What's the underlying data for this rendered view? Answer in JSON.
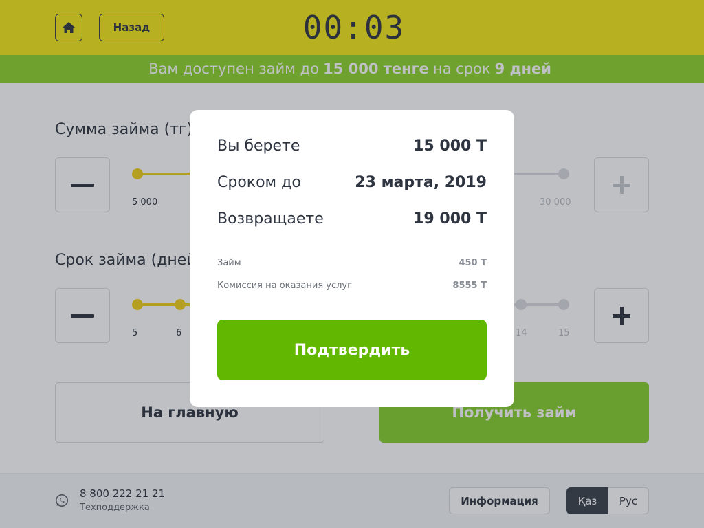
{
  "header": {
    "back_label": "Назад",
    "timer": "00:03",
    "colors": {
      "header_bg": "#f5ea18",
      "banner_bg": "#8fd32b"
    }
  },
  "banner": {
    "prefix": "Вам доступен займ до",
    "amount": "15 000 тенге",
    "middle": "на срок",
    "days": "9 дней"
  },
  "amount_section": {
    "title": "Сумма займа (тг)",
    "min_label": "5 000",
    "max_label": "30 000"
  },
  "term_section": {
    "title": "Срок займа (дней)",
    "ticks_left": [
      "5",
      "6"
    ],
    "ticks_right": [
      "14",
      "15"
    ]
  },
  "actions": {
    "home_label": "На главную",
    "get_loan_label": "Получить займ"
  },
  "footer": {
    "phone": "8 800 222 21 21",
    "support_label": "Техподдержка",
    "info_label": "Информация",
    "lang_kaz": "Қаз",
    "lang_rus": "Рус"
  },
  "modal": {
    "rows": [
      {
        "label": "Вы берете",
        "value": "15 000 Т"
      },
      {
        "label": "Сроком до",
        "value": "23 марта, 2019"
      },
      {
        "label": "Возвращаете",
        "value": "19 000 Т"
      }
    ],
    "details": [
      {
        "label": "Займ",
        "value": "450 Т"
      },
      {
        "label": "Комиссия на оказания услуг",
        "value": "8555 Т"
      }
    ],
    "confirm_label": "Подтвердить"
  },
  "icons": [
    "home-icon",
    "minus-icon",
    "plus-icon",
    "whatsapp-icon"
  ],
  "accent_colors": {
    "primary_green": "#62b800",
    "slider_yellow": "#f2d01b"
  }
}
